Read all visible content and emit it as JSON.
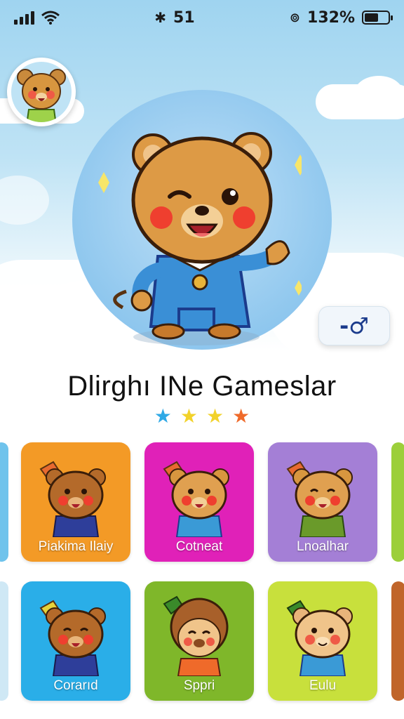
{
  "status_bar": {
    "center_text": "51",
    "battery_percent": "132%"
  },
  "colors": {
    "sky": "#9fd4f0",
    "hero_circle": "#8fc7ee",
    "star_colors": [
      "#2fa9e6",
      "#f2d22a",
      "#f2d22a",
      "#ef6a2a"
    ]
  },
  "hero": {
    "title": "Dlirghı INe Gameslar",
    "gender_symbol": "-♂",
    "rating": 4
  },
  "cards_row1": [
    {
      "label": "Piakima Ilaiy",
      "color": "#f39a26"
    },
    {
      "label": "Cotneat",
      "color": "#e021b8"
    },
    {
      "label": "Lnoalhar",
      "color": "#a47fd6"
    }
  ],
  "cards_row2": [
    {
      "label": "Corarıd",
      "color": "#2aaee8"
    },
    {
      "label": "Sppri",
      "color": "#7fb72a"
    },
    {
      "label": "Eulu",
      "color": "#c8e03c"
    }
  ]
}
